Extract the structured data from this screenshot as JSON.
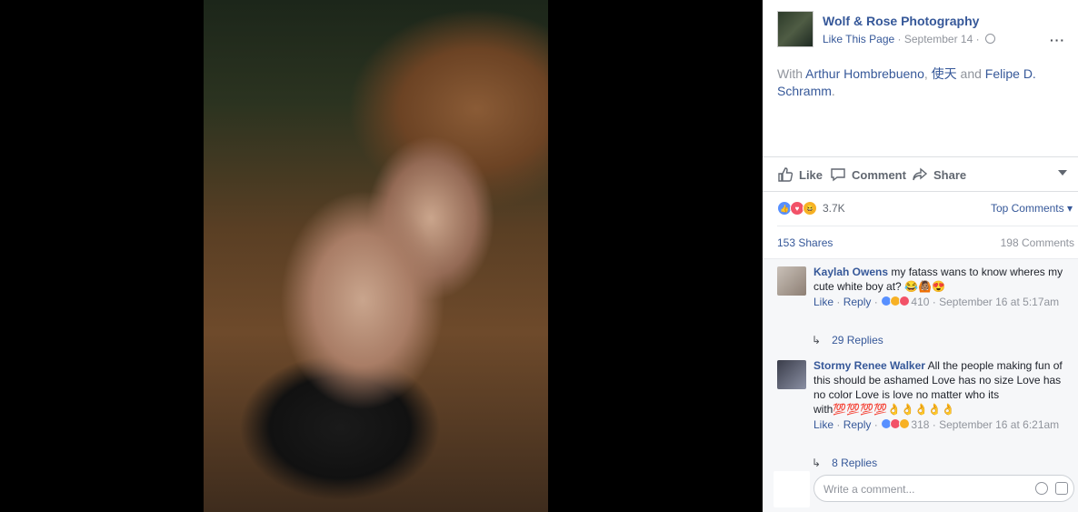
{
  "post": {
    "page_name": "Wolf & Rose Photography",
    "like_page": "Like This Page",
    "separator": "·",
    "date": "September 14",
    "options": "···",
    "with_prefix": "With",
    "tag1": "Arthur Hombrebueno",
    "comma": ",",
    "tag2": "使天",
    "and": "and",
    "tag3": "Felipe D. Schramm",
    "period": "."
  },
  "actions": {
    "like": "Like",
    "comment": "Comment",
    "share": "Share"
  },
  "stats": {
    "reactions_count": "3.7K",
    "top_comments": "Top Comments",
    "shares": "153 Shares",
    "comments": "198 Comments"
  },
  "comments": [
    {
      "author": "Kaylah Owens",
      "text": "my fatass wans to know wheres my cute white boy at? 😂🙆🏽😍",
      "like": "Like",
      "reply": "Reply",
      "reactions": "410",
      "time": "September 16 at 5:17am",
      "replies": "29 Replies"
    },
    {
      "author": "Stormy Renee Walker",
      "text": "All the people making fun of this should be ashamed Love has no size Love has no color Love is love no matter who its with💯💯💯💯👌👌👌👌👌",
      "like": "Like",
      "reply": "Reply",
      "reactions": "318",
      "time": "September 16 at 6:21am",
      "replies": "8 Replies"
    }
  ],
  "composer": {
    "placeholder": "Write a comment..."
  },
  "colors": {
    "link": "#365899",
    "muted": "#90949c",
    "like_blue": "#5890ff",
    "love_red": "#f25268",
    "haha_yellow": "#f7b125"
  }
}
